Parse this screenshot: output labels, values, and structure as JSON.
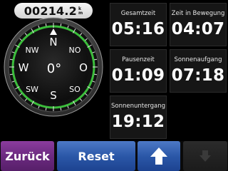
{
  "odometer": {
    "value": "00214.2",
    "unit_top": "k",
    "unit_bottom": "m"
  },
  "compass": {
    "north": "N",
    "south": "S",
    "east": "O",
    "west": "W",
    "northwest": "NW",
    "northeast": "NO",
    "southwest": "SW",
    "southeast": "SO",
    "heading": "0°"
  },
  "tiles": [
    {
      "label": "Gesamtzeit",
      "value": "05:16"
    },
    {
      "label": "Zeit in Bewegung",
      "value": "04:07"
    },
    {
      "label": "Pausenzeit",
      "value": "01:09"
    },
    {
      "label": "Sonnenaufgang",
      "value": "07:18"
    },
    {
      "label": "Sonnenuntergang",
      "value": "19:12"
    }
  ],
  "buttons": {
    "back": "Zurück",
    "reset": "Reset",
    "up_icon": "arrow-up-icon",
    "down_icon": "arrow-down-icon"
  },
  "colors": {
    "compass_ring": "#3bbd3b",
    "back_button": "#6c2a80",
    "blue_button": "#2b58a8"
  }
}
